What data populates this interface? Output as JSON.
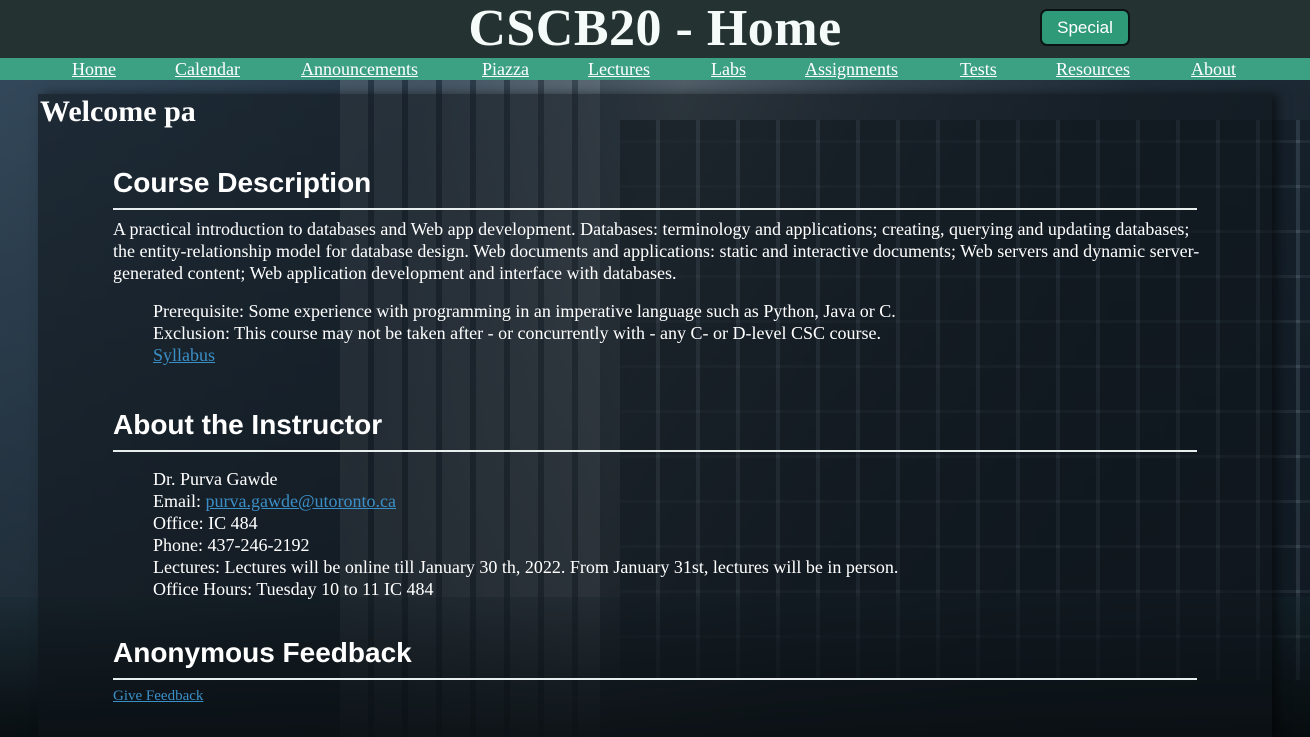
{
  "header": {
    "title": "CSCB20 - Home",
    "special_button": "Special"
  },
  "nav": [
    {
      "label": "Home"
    },
    {
      "label": "Calendar"
    },
    {
      "label": "Announcements"
    },
    {
      "label": "Piazza"
    },
    {
      "label": "Lectures"
    },
    {
      "label": "Labs"
    },
    {
      "label": "Assignments"
    },
    {
      "label": "Tests"
    },
    {
      "label": "Resources"
    },
    {
      "label": "About"
    }
  ],
  "welcome": "Welcome pa",
  "course": {
    "heading": "Course Description",
    "description": "A practical introduction to databases and Web app development. Databases: terminology and applications; creating, querying and updating databases; the entity-relationship model for database design. Web documents and applications: static and interactive documents; Web servers and dynamic server-generated content; Web application development and interface with databases.",
    "prerequisite": "Prerequisite: Some experience with programming in an imperative language such as Python, Java or C.",
    "exclusion": "Exclusion: This course may not be taken after - or concurrently with - any C- or D-level CSC course.",
    "syllabus_link": "Syllabus"
  },
  "instructor": {
    "heading": "About the Instructor",
    "name": "Dr. Purva Gawde",
    "email_label": "Email: ",
    "email": "purva.gawde@utoronto.ca",
    "office": "Office: IC 484",
    "phone": "Phone: 437-246-2192",
    "lectures": "Lectures: Lectures will be online till January 30 th, 2022. From January 31st, lectures will be in person.",
    "office_hours": "Office Hours: Tuesday 10 to 11 IC 484"
  },
  "feedback": {
    "heading": "Anonymous Feedback",
    "link": "Give Feedback"
  },
  "colors": {
    "header_bg": "#243231",
    "nav_bg": "#3ca083",
    "button_bg": "#2f9a78",
    "link": "#3b8fc7"
  }
}
